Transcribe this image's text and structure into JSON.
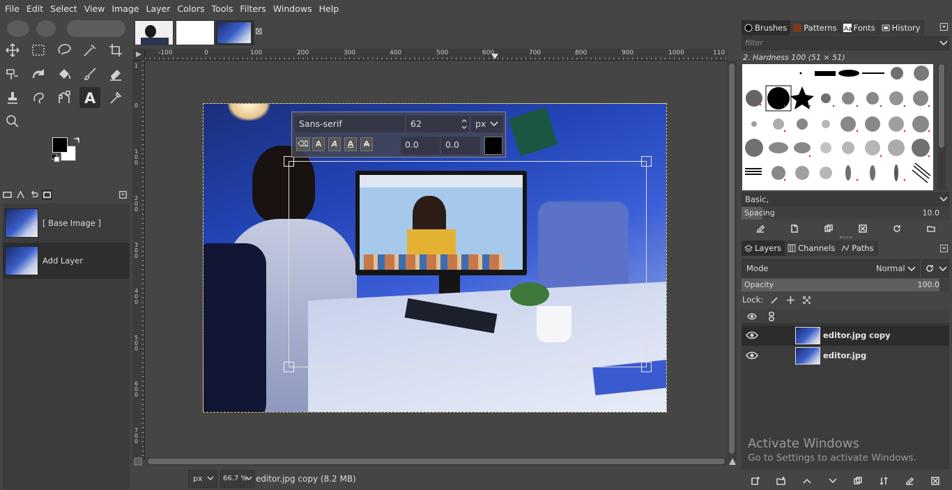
{
  "menubar": {
    "items": [
      "File",
      "Edit",
      "Select",
      "View",
      "Image",
      "Layer",
      "Colors",
      "Tools",
      "Filters",
      "Windows",
      "Help"
    ]
  },
  "toolbox": {
    "tools": [
      "move-tool",
      "rect-select-tool",
      "free-select-tool",
      "fuzzy-select-tool",
      "crop-tool",
      "unified-transform-tool",
      "warp-transform-tool",
      "bucket-fill-tool",
      "paintbrush-tool",
      "eraser-tool",
      "clone-tool",
      "smudge-tool",
      "paths-tool",
      "text-tool",
      "color-picker-tool",
      "zoom-tool"
    ],
    "active_tool": "text-tool",
    "fg_color": "#000000",
    "bg_color": "#ffffff"
  },
  "left_dock": {
    "items": [
      "[ Base Image ]",
      "Add Layer"
    ],
    "selected": "Add Layer"
  },
  "canvas": {
    "ruler_labels": [
      "-100",
      "0",
      "100",
      "200",
      "300",
      "400",
      "500",
      "600",
      "700",
      "800",
      "900",
      "1000",
      "110"
    ],
    "vruler_labels": [
      "0",
      "1",
      "100",
      "200",
      "300",
      "400",
      "500",
      "600",
      "700"
    ],
    "text_tool": {
      "font": "Sans-serif",
      "size": "62",
      "unit": "px",
      "baseline": "0.0",
      "kerning": "0.0",
      "style_buttons": [
        "A",
        "A",
        "A",
        "A"
      ],
      "color": "#000000"
    },
    "watermark_tab_close": "⊠"
  },
  "statusbar": {
    "unit": "px",
    "zoom": "66.7 %",
    "info": "editor.jpg copy (8.2 MB)"
  },
  "right_dock": {
    "tabs": [
      "Brushes",
      "Patterns",
      "Fonts",
      "History"
    ],
    "filter_placeholder": "filter",
    "brush_name": "2. Hardness 100 (51 × 51)",
    "brush_set": "Basic,",
    "spacing_label": "Spacing",
    "spacing_value": "10.0",
    "spacing_fill": 0.1,
    "layer_tabs": [
      "Layers",
      "Channels",
      "Paths"
    ],
    "mode_label": "Mode",
    "mode_value": "Normal",
    "opacity_label": "Opacity",
    "opacity_value": "100.0",
    "opacity_fill": 1.0,
    "lock_label": "Lock:",
    "layers": [
      {
        "name": "editor.jpg copy",
        "selected": true
      },
      {
        "name": "editor.jpg",
        "selected": false
      }
    ]
  },
  "watermark": {
    "line1": "Activate Windows",
    "line2": "Go to Settings to activate Windows."
  }
}
